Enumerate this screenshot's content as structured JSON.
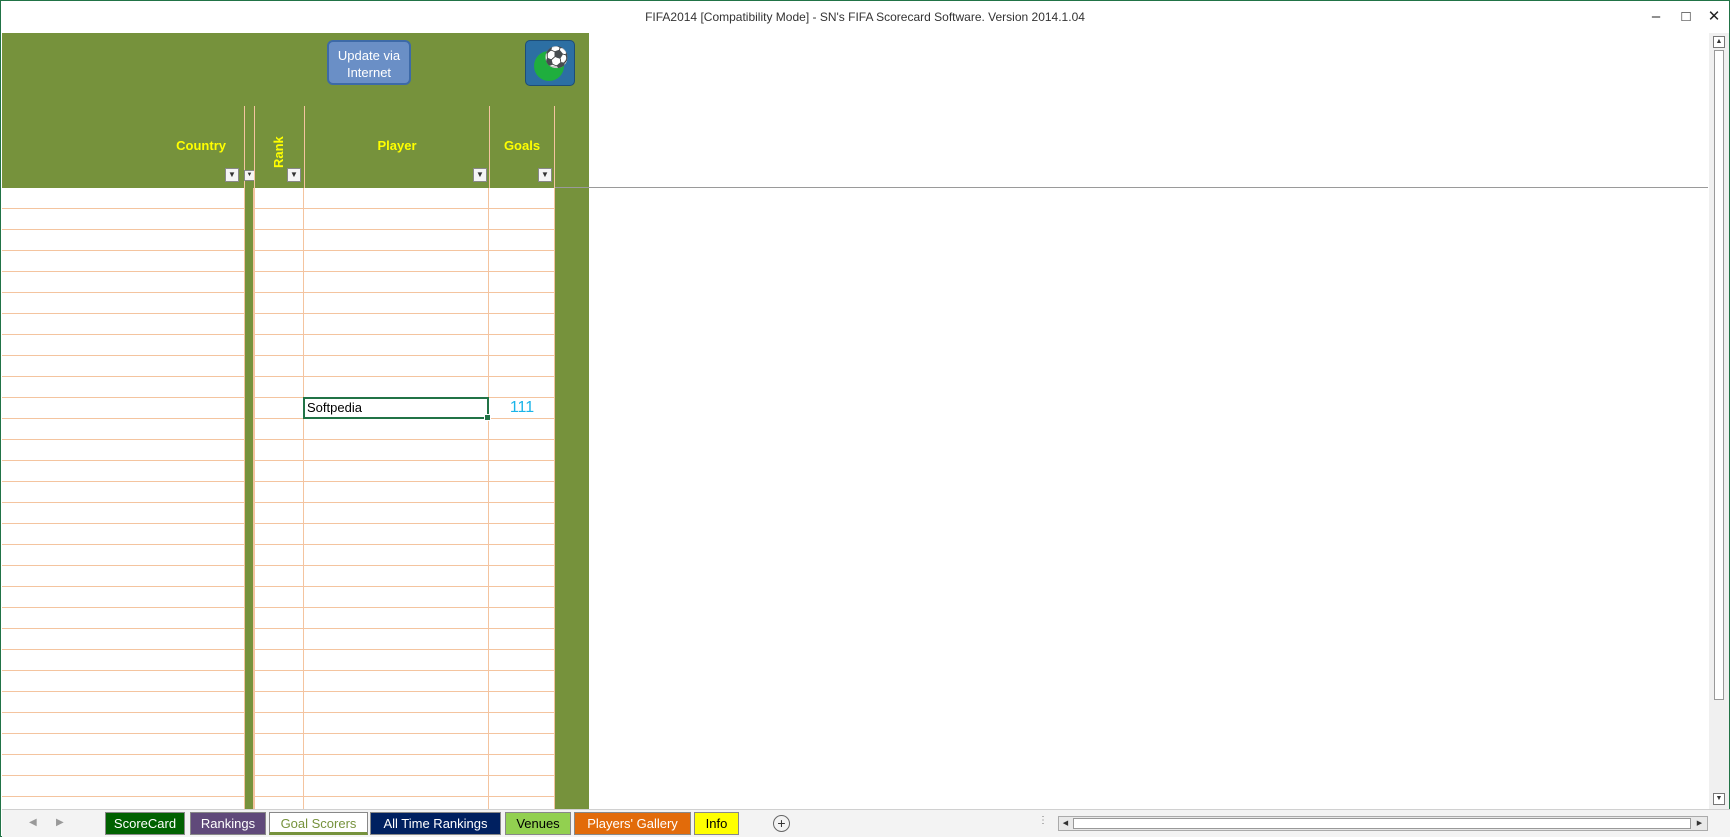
{
  "window": {
    "title": "FIFA2014  [Compatibility Mode] - SN's FIFA Scorecard Software.  Version 2014.1.04",
    "minimize_glyph": "–",
    "maximize_glyph": "□",
    "close_glyph": "✕"
  },
  "toolbar": {
    "update_button_label": "Update via Internet",
    "logo_icon": "soccer-player-icon"
  },
  "table": {
    "headers": {
      "country": "Country",
      "rank": "Rank",
      "player": "Player",
      "goals": "Goals"
    },
    "filter_glyph": "▼",
    "rows": [
      {
        "player": "Softpedia",
        "goals": "111"
      }
    ]
  },
  "sheet_tabs": [
    {
      "label": "ScoreCard",
      "bg": "#006100",
      "fg": "#ffffff",
      "active": false
    },
    {
      "label": "Rankings",
      "bg": "#60497a",
      "fg": "#ffffff",
      "active": false
    },
    {
      "label": "Goal Scorers",
      "bg": "#ffffff",
      "fg": "#76923c",
      "active": true
    },
    {
      "label": "All Time Rankings",
      "bg": "#002060",
      "fg": "#ffffff",
      "active": false
    },
    {
      "label": "Venues",
      "bg": "#92d050",
      "fg": "#000000",
      "active": false
    },
    {
      "label": "Players' Gallery",
      "bg": "#e26b0a",
      "fg": "#ffffff",
      "active": false
    },
    {
      "label": "Info",
      "bg": "#ffff00",
      "fg": "#000000",
      "active": false
    }
  ],
  "colors": {
    "header_band": "#76923c",
    "header_text": "#ffff00",
    "grid_line": "#f4c49f",
    "selection": "#217346",
    "goals_value": "#1ab4e8"
  }
}
